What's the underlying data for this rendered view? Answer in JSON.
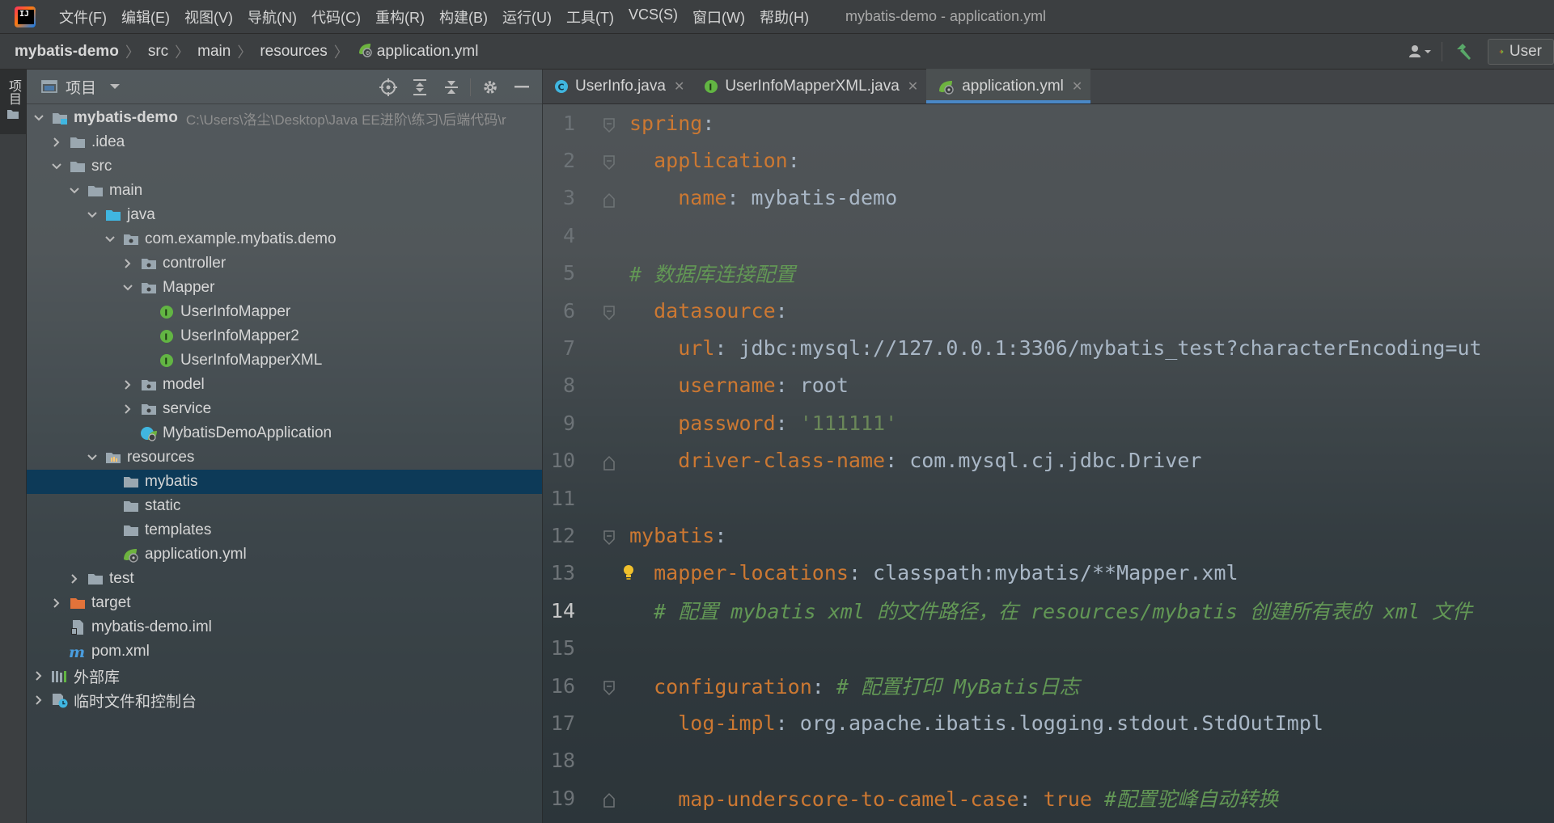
{
  "menu": {
    "items": [
      "文件(F)",
      "编辑(E)",
      "视图(V)",
      "导航(N)",
      "代码(C)",
      "重构(R)",
      "构建(B)",
      "运行(U)",
      "工具(T)",
      "VCS(S)",
      "窗口(W)",
      "帮助(H)"
    ],
    "window_title": "mybatis-demo - application.yml"
  },
  "breadcrumb": [
    "mybatis-demo",
    "src",
    "main",
    "resources",
    "application.yml"
  ],
  "run_config": {
    "label": "User"
  },
  "toolstrip": {
    "label": "项目"
  },
  "project_panel": {
    "title": "项目",
    "tree": [
      {
        "label": "mybatis-demo",
        "path": "C:\\Users\\洛尘\\Desktop\\Java EE进阶\\练习\\后端代码\\r",
        "level": 0,
        "chevron": "open",
        "icon": "module-folder-icon",
        "bold": true
      },
      {
        "label": ".idea",
        "level": 1,
        "chevron": "closed",
        "icon": "folder-icon"
      },
      {
        "label": "src",
        "level": 1,
        "chevron": "open",
        "icon": "folder-icon"
      },
      {
        "label": "main",
        "level": 2,
        "chevron": "open",
        "icon": "folder-icon"
      },
      {
        "label": "java",
        "level": 3,
        "chevron": "open",
        "icon": "source-folder-icon"
      },
      {
        "label": "com.example.mybatis.demo",
        "level": 4,
        "chevron": "open",
        "icon": "package-icon"
      },
      {
        "label": "controller",
        "level": 5,
        "chevron": "closed",
        "icon": "package-icon"
      },
      {
        "label": "Mapper",
        "level": 5,
        "chevron": "open",
        "icon": "package-icon"
      },
      {
        "label": "UserInfoMapper",
        "level": 6,
        "chevron": "none",
        "icon": "interface-icon"
      },
      {
        "label": "UserInfoMapper2",
        "level": 6,
        "chevron": "none",
        "icon": "interface-icon"
      },
      {
        "label": "UserInfoMapperXML",
        "level": 6,
        "chevron": "none",
        "icon": "interface-icon"
      },
      {
        "label": "model",
        "level": 5,
        "chevron": "closed",
        "icon": "package-icon"
      },
      {
        "label": "service",
        "level": 5,
        "chevron": "closed",
        "icon": "package-icon"
      },
      {
        "label": "MybatisDemoApplication",
        "level": 5,
        "chevron": "none",
        "icon": "spring-app-icon"
      },
      {
        "label": "resources",
        "level": 3,
        "chevron": "open",
        "icon": "resources-folder-icon"
      },
      {
        "label": "mybatis",
        "level": 4,
        "chevron": "none",
        "icon": "folder-icon",
        "selected": true
      },
      {
        "label": "static",
        "level": 4,
        "chevron": "none",
        "icon": "folder-icon"
      },
      {
        "label": "templates",
        "level": 4,
        "chevron": "none",
        "icon": "folder-icon"
      },
      {
        "label": "application.yml",
        "level": 4,
        "chevron": "none",
        "icon": "yaml-spring-icon"
      },
      {
        "label": "test",
        "level": 2,
        "chevron": "closed",
        "icon": "folder-icon"
      },
      {
        "label": "target",
        "level": 1,
        "chevron": "closed",
        "icon": "excluded-folder-icon"
      },
      {
        "label": "mybatis-demo.iml",
        "level": 1,
        "chevron": "none",
        "icon": "iml-file-icon"
      },
      {
        "label": "pom.xml",
        "level": 1,
        "chevron": "none",
        "icon": "maven-icon"
      },
      {
        "label": "外部库",
        "level": 0,
        "chevron": "closed",
        "icon": "library-icon"
      },
      {
        "label": "临时文件和控制台",
        "level": 0,
        "chevron": "closed",
        "icon": "scratch-icon"
      }
    ]
  },
  "editor": {
    "tabs": [
      {
        "label": "UserInfo.java",
        "icon": "class-icon",
        "active": false
      },
      {
        "label": "UserInfoMapperXML.java",
        "icon": "interface-icon",
        "active": false
      },
      {
        "label": "application.yml",
        "icon": "yaml-spring-icon",
        "active": true
      }
    ],
    "current_line": 14,
    "lines": [
      {
        "n": "1",
        "fold": "open",
        "tokens": [
          [
            "k",
            "spring"
          ],
          [
            "v",
            ":"
          ]
        ]
      },
      {
        "n": "2",
        "fold": "open",
        "tokens": [
          [
            "v",
            "  "
          ],
          [
            "k",
            "application"
          ],
          [
            "v",
            ":"
          ]
        ]
      },
      {
        "n": "3",
        "fold": "end",
        "tokens": [
          [
            "v",
            "    "
          ],
          [
            "k",
            "name"
          ],
          [
            "v",
            ": mybatis-demo"
          ]
        ]
      },
      {
        "n": "4",
        "fold": "",
        "tokens": []
      },
      {
        "n": "5",
        "fold": "",
        "tokens": [
          [
            "c",
            "# 数据库连接配置"
          ]
        ]
      },
      {
        "n": "6",
        "fold": "open",
        "tokens": [
          [
            "v",
            "  "
          ],
          [
            "k",
            "datasource"
          ],
          [
            "v",
            ":"
          ]
        ]
      },
      {
        "n": "7",
        "fold": "",
        "tokens": [
          [
            "v",
            "    "
          ],
          [
            "k",
            "url"
          ],
          [
            "v",
            ": jdbc:mysql://127.0.0.1:3306/mybatis_test?characterEncoding=ut"
          ]
        ]
      },
      {
        "n": "8",
        "fold": "",
        "tokens": [
          [
            "v",
            "    "
          ],
          [
            "k",
            "username"
          ],
          [
            "v",
            ": root"
          ]
        ]
      },
      {
        "n": "9",
        "fold": "",
        "tokens": [
          [
            "v",
            "    "
          ],
          [
            "k",
            "password"
          ],
          [
            "v",
            ": "
          ],
          [
            "s",
            "'111111'"
          ]
        ]
      },
      {
        "n": "10",
        "fold": "end",
        "tokens": [
          [
            "v",
            "    "
          ],
          [
            "k",
            "driver-class-name"
          ],
          [
            "v",
            ": com.mysql.cj.jdbc.Driver"
          ]
        ]
      },
      {
        "n": "11",
        "fold": "",
        "tokens": []
      },
      {
        "n": "12",
        "fold": "open",
        "tokens": [
          [
            "k",
            "mybatis"
          ],
          [
            "v",
            ":"
          ]
        ]
      },
      {
        "n": "13",
        "fold": "",
        "bulb": true,
        "tokens": [
          [
            "v",
            "  "
          ],
          [
            "k",
            "mapper-locations"
          ],
          [
            "v",
            ": classpath:mybatis/**Mapper.xml"
          ]
        ]
      },
      {
        "n": "14",
        "fold": "",
        "tokens": [
          [
            "v",
            "  "
          ],
          [
            "c",
            "# 配置 mybatis xml 的文件路径，在 resources/mybatis 创建所有表的 xml 文件"
          ]
        ]
      },
      {
        "n": "15",
        "fold": "",
        "tokens": []
      },
      {
        "n": "16",
        "fold": "open",
        "tokens": [
          [
            "v",
            "  "
          ],
          [
            "k",
            "configuration"
          ],
          [
            "v",
            ": "
          ],
          [
            "c",
            "# 配置打印 MyBatis日志"
          ]
        ]
      },
      {
        "n": "17",
        "fold": "",
        "tokens": [
          [
            "v",
            "    "
          ],
          [
            "k",
            "log-impl"
          ],
          [
            "v",
            ": org.apache.ibatis.logging.stdout.StdOutImpl"
          ]
        ]
      },
      {
        "n": "18",
        "fold": "",
        "tokens": []
      },
      {
        "n": "19",
        "fold": "end",
        "tokens": [
          [
            "v",
            "    "
          ],
          [
            "k",
            "map-underscore-to-camel-case"
          ],
          [
            "v",
            ": "
          ],
          [
            "kw",
            "true"
          ],
          [
            "v",
            " "
          ],
          [
            "c",
            "#配置驼峰自动转换"
          ]
        ]
      }
    ]
  },
  "colors": {
    "accent": "#4a88c7",
    "selection": "#0d3a58",
    "yaml_key": "#cc7832",
    "yaml_value": "#a9b7c6",
    "yaml_string": "#6a8759",
    "yaml_comment": "#629755"
  }
}
